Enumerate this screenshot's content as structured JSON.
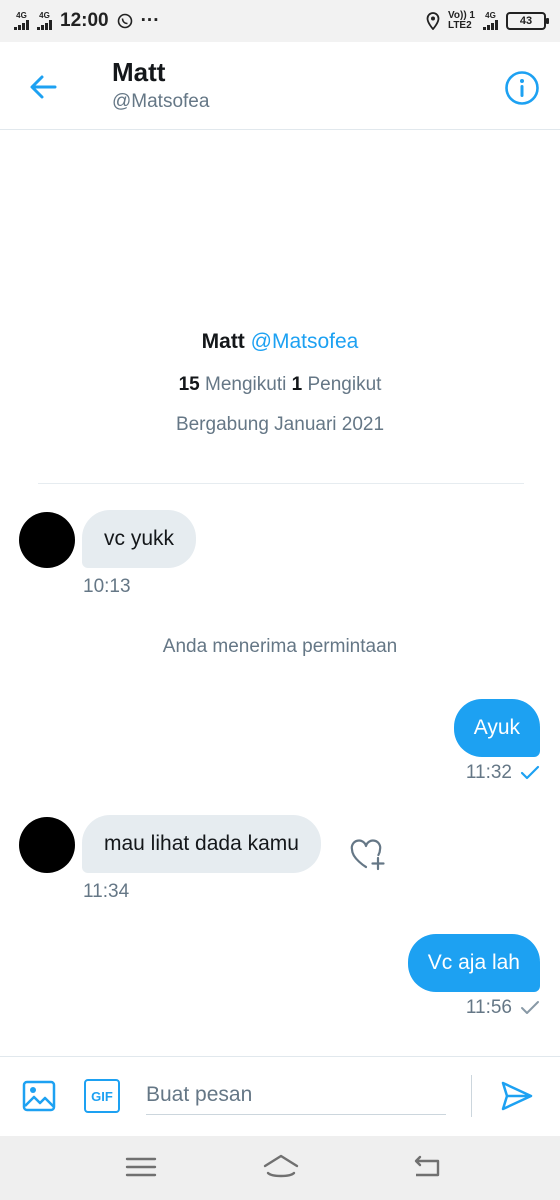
{
  "status_bar": {
    "network1": "4G",
    "network2": "4G",
    "time": "12:00",
    "dots": "···",
    "volte": "Vo)) 1",
    "lte": "LTE2",
    "net_right": "4G",
    "battery": "43"
  },
  "header": {
    "name": "Matt",
    "handle": "@Matsofea",
    "back_icon": "arrow-left-icon",
    "info_icon": "info-icon"
  },
  "profile": {
    "name": "Matt",
    "handle": "@Matsofea",
    "following_count": "15",
    "following_label": "Mengikuti",
    "followers_count": "1",
    "followers_label": "Pengikut",
    "joined": "Bergabung Januari 2021"
  },
  "messages": [
    {
      "direction": "in",
      "text": "vc yukk",
      "time": "10:13"
    },
    {
      "direction": "system",
      "text": "Anda menerima permintaan"
    },
    {
      "direction": "out",
      "text": "Ayuk",
      "time": "11:32"
    },
    {
      "direction": "in",
      "text": "mau lihat dada kamu",
      "time": "11:34"
    },
    {
      "direction": "out",
      "text": "Vc aja lah",
      "time": "11:56"
    }
  ],
  "composer": {
    "placeholder": "Buat pesan",
    "image_icon": "image-icon",
    "gif_icon": "gif-icon",
    "gif_label": "GIF",
    "send_icon": "send-icon"
  },
  "colors": {
    "accent": "#1da1f2",
    "muted": "#657786",
    "incoming_bubble": "#e6ecf0"
  }
}
